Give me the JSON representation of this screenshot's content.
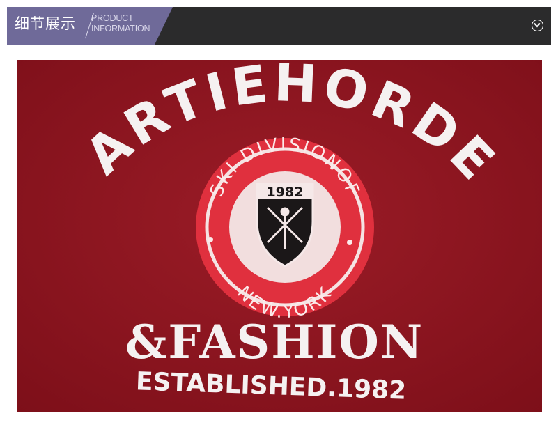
{
  "header": {
    "title": "细节展示",
    "subtitle_line1": "PRODUCT",
    "subtitle_line2": "INFORMATION",
    "expand_icon": "chevron-down-icon"
  },
  "photo": {
    "arc_text": "ARTIEHORDE",
    "badge_top_text": "SKI DIVISIONOF",
    "badge_year": "1982",
    "badge_bottom_text": "NEW.YORK",
    "headline": "&FASHION",
    "tagline": "ESTABLISHED.1982"
  },
  "colors": {
    "banner_bg": "#2b2b2c",
    "banner_accent": "#6f6a99",
    "fabric_red": "#8d1520",
    "print_white": "#f5f1f1"
  }
}
